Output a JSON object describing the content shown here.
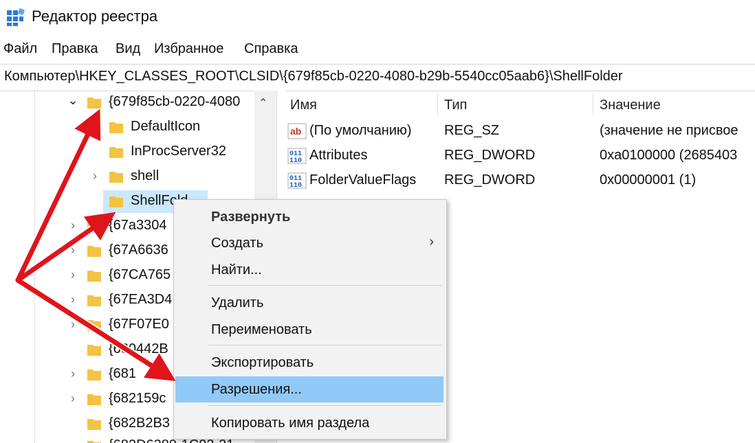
{
  "window": {
    "title": "Редактор реестра",
    "icon": "regedit-icon"
  },
  "menu": [
    "Файл",
    "Правка",
    "Вид",
    "Избранное",
    "Справка"
  ],
  "address": "Компьютер\\HKEY_CLASSES_ROOT\\CLSID\\{679f85cb-0220-4080-b29b-5540cc05aab6}\\ShellFolder",
  "tree": {
    "parent": "{679f85cb-0220-4080",
    "children": [
      "DefaultIcon",
      "InProcServer32",
      "shell",
      "ShellFolder"
    ],
    "selected_visible": "ShellFold",
    "siblings": [
      "{67a3304",
      "{67A6636",
      "{67CA765",
      "{67EA3D4",
      "{67F07E0",
      "{680442B",
      "{681",
      "{682159c",
      "{682B2B3",
      "{682D6389-1C02-21"
    ]
  },
  "list": {
    "columns": [
      "Имя",
      "Тип",
      "Значение"
    ],
    "rows": [
      {
        "icon": "string-value-icon",
        "name": "(По умолчанию)",
        "type": "REG_SZ",
        "value": "(значение не присвое"
      },
      {
        "icon": "binary-value-icon",
        "name": "Attributes",
        "type": "REG_DWORD",
        "value": "0xa0100000 (2685403"
      },
      {
        "icon": "binary-value-icon",
        "name": "FolderValueFlags",
        "type": "REG_DWORD",
        "value": "0x00000001 (1)"
      }
    ]
  },
  "context_menu": {
    "items": [
      "Развернуть",
      "Создать",
      "Найти...",
      "Удалить",
      "Переименовать",
      "Экспортировать",
      "Разрешения...",
      "Копировать имя раздела"
    ],
    "highlighted": "Разрешения..."
  },
  "colors": {
    "selection": "#cce8ff",
    "menu_hover": "#91c9f7",
    "arrow": "#e0141b",
    "folder": "#f5c242"
  }
}
